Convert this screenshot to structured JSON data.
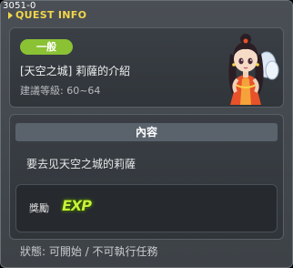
{
  "window": {
    "quest_id": "3051-0",
    "title": "QUEST INFO"
  },
  "quest": {
    "category_badge": "一般",
    "name": "[天空之城] 莉薩的介紹",
    "level_range": "建議等級: 60~64"
  },
  "npc": {
    "icon": "npc-portrait-icon"
  },
  "content": {
    "header": "內容",
    "description": "要去见天空之城的莉薩"
  },
  "reward": {
    "label": "獎勵",
    "exp_label": "EXP",
    "exp_icon": "exp-icon"
  },
  "status": {
    "text": "狀態:  可開始 / 不可執行任務"
  },
  "colors": {
    "title": "#f2d64a",
    "badge": "#8ac234",
    "exp": "#c8f03a"
  }
}
